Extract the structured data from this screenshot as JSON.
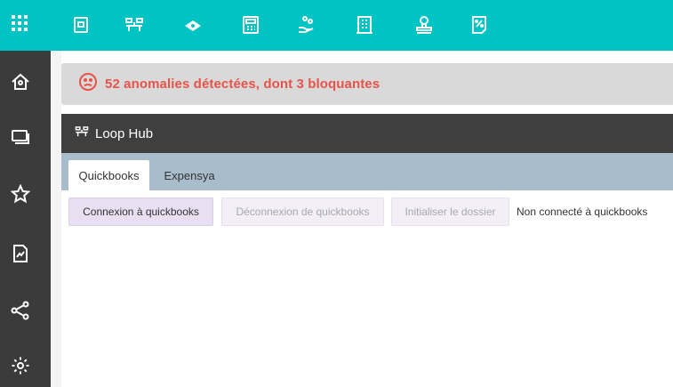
{
  "topbar": {
    "apps_icon": "grid-icon",
    "icons": [
      "document-icon",
      "hub-icon",
      "money-icon",
      "calculator-icon",
      "hand-coins-icon",
      "building-icon",
      "stamp-icon",
      "percent-document-icon"
    ]
  },
  "sidebar": {
    "icons": [
      "home-icon",
      "cards-icon",
      "star-icon",
      "report-icon",
      "share-icon",
      "settings-icon"
    ]
  },
  "alert": {
    "text": "52 anomalies détectées, dont 3 bloquantes",
    "color": "#e8534a"
  },
  "panel": {
    "title": "Loop Hub",
    "tabs": [
      {
        "label": "Quickbooks",
        "active": true
      },
      {
        "label": "Expensya",
        "active": false
      }
    ],
    "buttons": {
      "connect": "Connexion à quickbooks",
      "disconnect": "Déconnexion de quickbooks",
      "init": "Initialiser le dossier"
    },
    "status": "Non connecté à quickbooks"
  },
  "colors": {
    "topbar": "#00c4c4",
    "sidebar": "#3b3b3b",
    "panel_header": "#3f3f3f",
    "tabbar": "#a9bccb"
  }
}
